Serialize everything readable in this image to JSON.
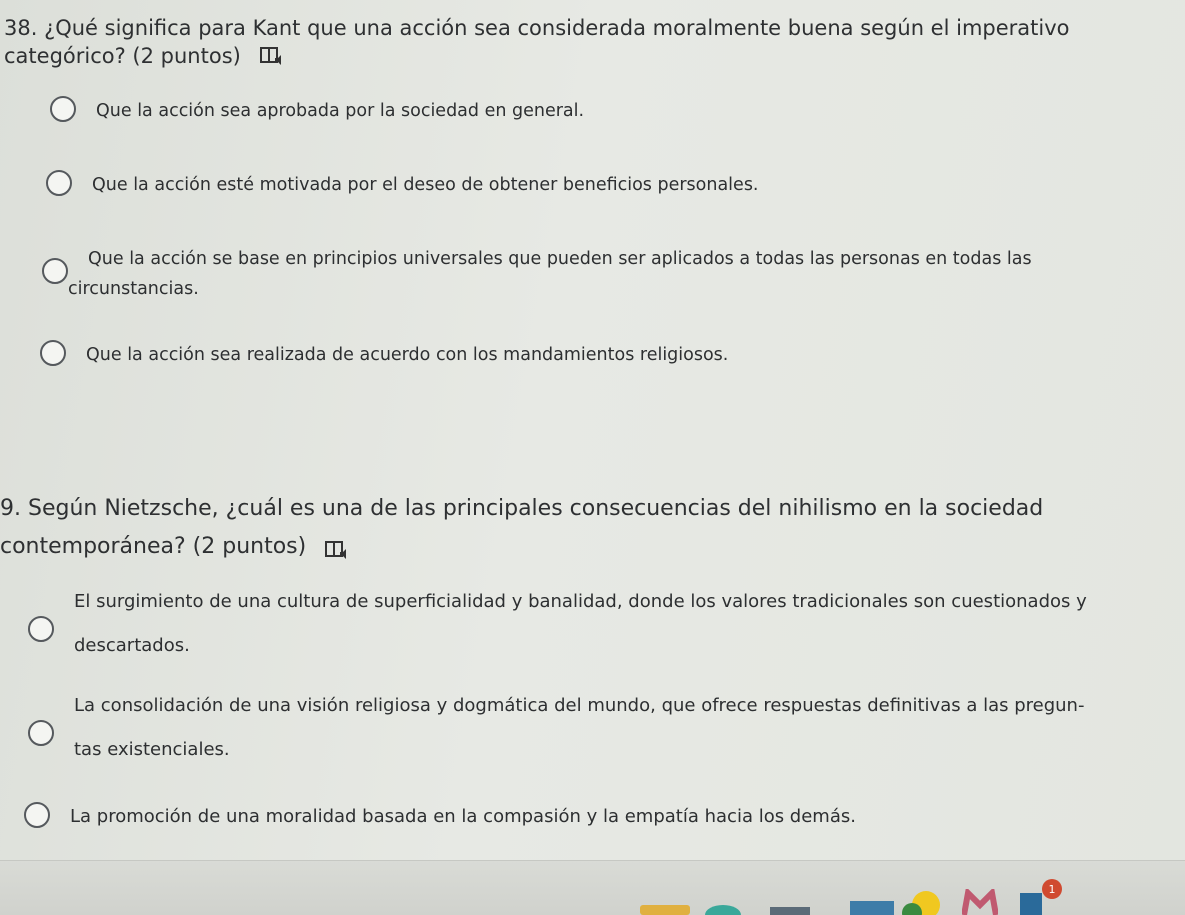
{
  "questions": [
    {
      "title": "38. ¿Qué significa para Kant que una acción sea considerada moralmente buena según el imperativo categórico? (2 puntos)",
      "options": [
        "Que la acción sea aprobada por la sociedad en general.",
        "Que la acción esté motivada por el deseo de obtener beneficios personales.",
        "Que la acción se base en principios universales que pueden ser aplicados a todas las personas en todas las circunstancias.",
        "Que la acción sea realizada de acuerdo con los mandamientos religiosos."
      ]
    },
    {
      "title": "9. Según Nietzsche, ¿cuál es una de las principales consecuencias del nihilismo en la sociedad contemporánea? (2 puntos)",
      "options": [
        "El surgimiento de una cultura de superficialidad y banalidad, donde los valores tradicionales son cuestionados y descartados.",
        "La consolidación de una visión religiosa y dogmática del mundo, que ofrece respuestas definitivas a las pregun- tas existenciales.",
        "La promoción de una moralidad basada en la compasión y la empatía hacia los demás."
      ]
    }
  ],
  "icons": {
    "question_icon": "immersive-reader-icon",
    "taskbar": [
      "taskbar-app-icon",
      "mail-icon",
      "notification-badge-icon"
    ]
  },
  "taskbar": {
    "notification_count": "1"
  }
}
